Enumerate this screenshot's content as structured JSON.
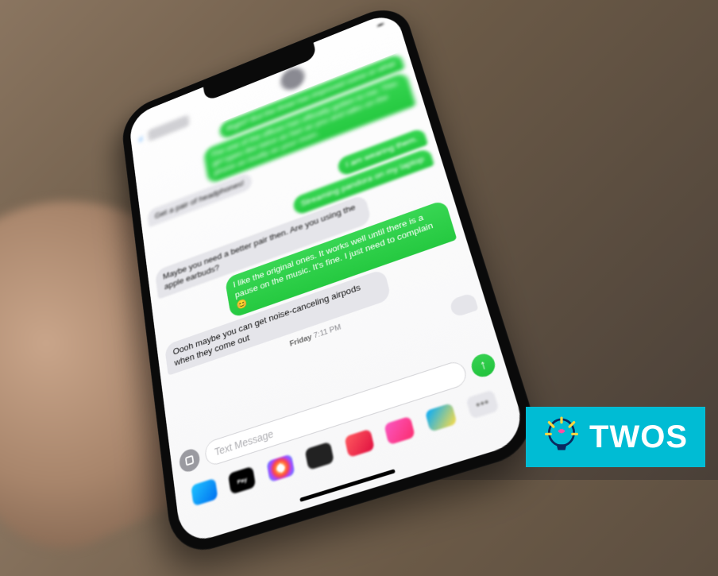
{
  "status": {
    "time": "",
    "indicators": "•••"
  },
  "messages": [
    {
      "side": "sent",
      "blur": "blur-3",
      "text": "Right? But the three has improved some or what"
    },
    {
      "side": "sent",
      "blur": "blur-3",
      "text": "The one of the offices has officially gotten to me. This girl types like twice as fast as you and talks on the phone as loudly as your mom."
    },
    {
      "side": "recv",
      "blur": "blur-2",
      "text": "Get a pair of headphones!"
    },
    {
      "side": "sent",
      "blur": "blur-2",
      "text": "I am wearing them."
    },
    {
      "side": "sent",
      "blur": "blur-2",
      "text": "Streaming pandora on my laptop"
    },
    {
      "side": "recv",
      "blur": "blur-1",
      "text": "Maybe you need a better pair then. Are you using the apple earbuds?"
    },
    {
      "side": "sent",
      "blur": "blur-0",
      "text": "I like the original ones. It works well until there is a pause on the music. It's fine. I just need to complain 😊"
    },
    {
      "side": "recv",
      "blur": "blur-0",
      "text": "Oooh maybe you can get noise-canceling airpods when they come out"
    }
  ],
  "timestamp": {
    "day": "Friday",
    "time": "7:11 PM"
  },
  "input": {
    "placeholder": "Text Message"
  },
  "apps": {
    "pay_label": "Pay"
  },
  "brand": {
    "text": "TWOS"
  }
}
